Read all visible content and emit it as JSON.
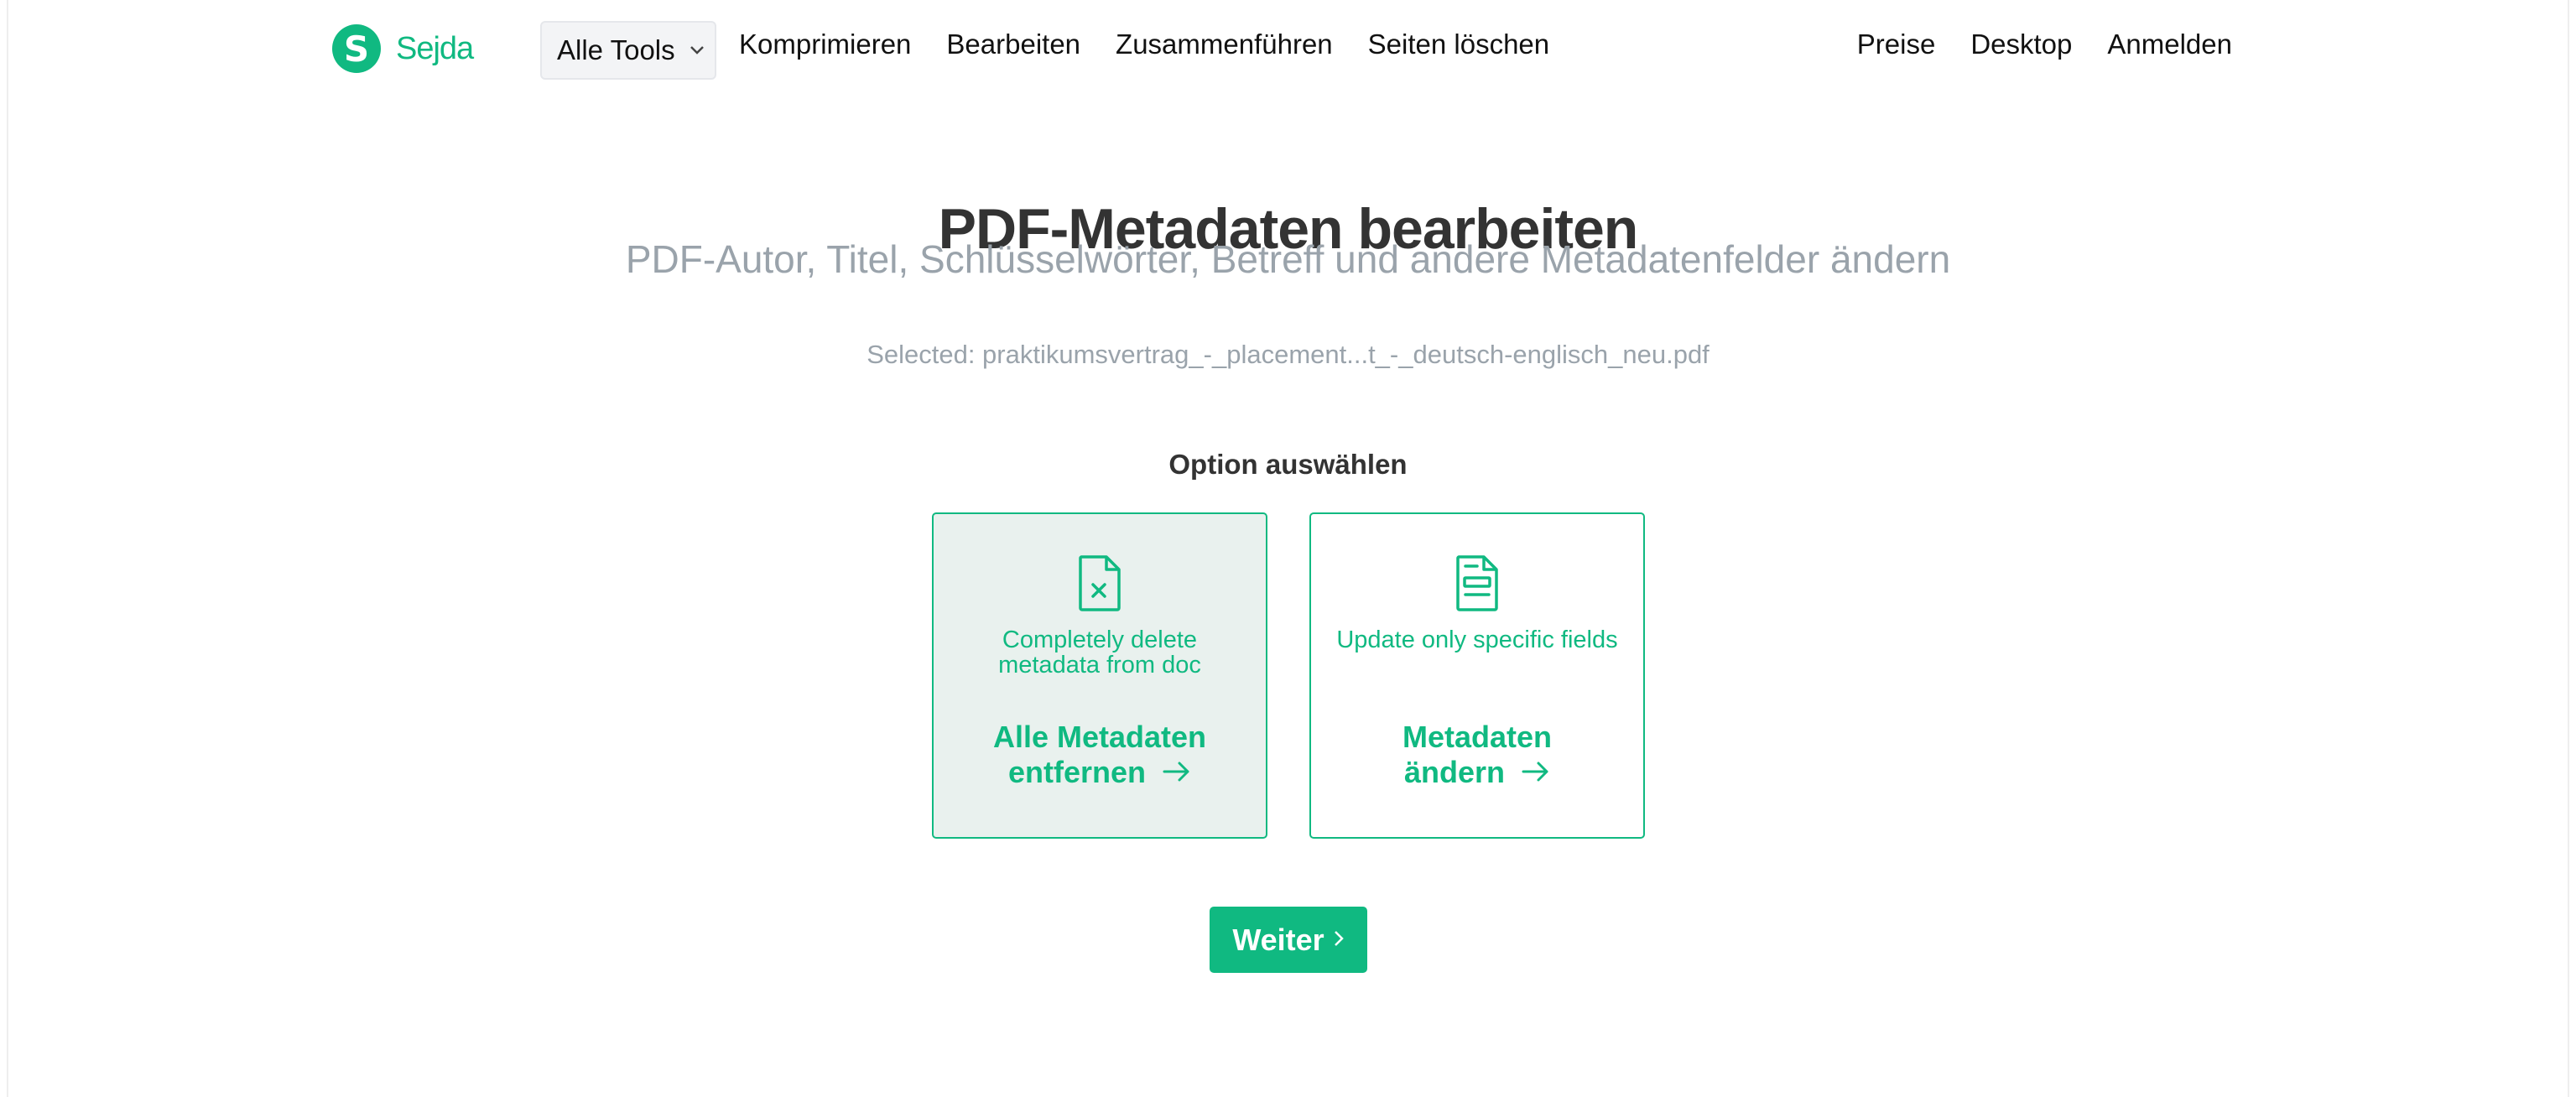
{
  "header": {
    "logo_letter": "S",
    "logo_text": "Sejda",
    "tools_dropdown": "Alle Tools",
    "nav_links": [
      "Komprimieren",
      "Bearbeiten",
      "Zusammenführen",
      "Seiten löschen"
    ],
    "right_links": [
      "Preise",
      "Desktop",
      "Anmelden"
    ]
  },
  "main": {
    "title": "PDF-Metadaten bearbeiten",
    "subtitle": "PDF-Autor, Titel, Schlüsselwörter, Betreff und andere Metadatenfelder ändern",
    "selected_file": "Selected: praktikumsvertrag_-_placement...t_-_deutsch-englisch_neu.pdf",
    "option_heading": "Option auswählen",
    "options": [
      {
        "description": "Completely delete metadata from doc",
        "action_line1": "Alle Metadaten",
        "action_line2": "entfernen",
        "icon": "file-x-icon",
        "selected": true
      },
      {
        "description": "Update only specific fields",
        "action_line1": "Metadaten",
        "action_line2": "ändern",
        "icon": "file-form-icon",
        "selected": false
      }
    ],
    "continue_label": "Weiter"
  },
  "colors": {
    "accent": "#10b981",
    "selected_bg": "#e9f1ee",
    "muted_text": "#9aa3ab",
    "heading_text": "#333333"
  }
}
